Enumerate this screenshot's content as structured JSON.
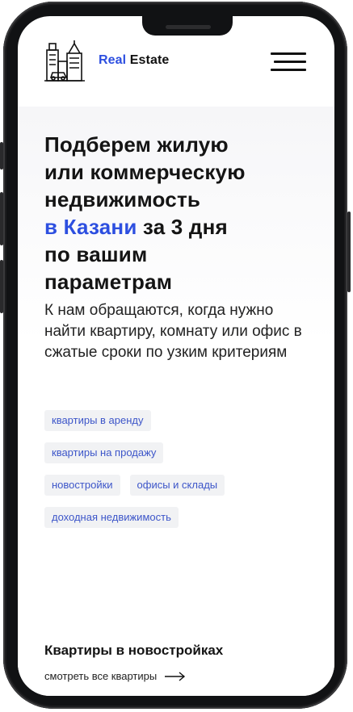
{
  "header": {
    "brand_accent": "Real",
    "brand_rest": " Estate",
    "logo_icon": "city-buildings-icon",
    "menu_icon": "hamburger-menu-icon"
  },
  "hero": {
    "headline_line1": "Подберем жилую",
    "headline_line2": "или коммерческую",
    "headline_line3": "недвижимость",
    "headline_accent": "в Казани",
    "headline_after_accent": " за 3 дня",
    "headline_line5": "по вашим",
    "headline_line6": "параметрам",
    "subtitle": "К нам обращаются, когда нужно найти квартиру, комнату или офис в сжатые сроки по узким критериям"
  },
  "tags": [
    [
      "квартиры в аренду"
    ],
    [
      "квартиры на продажу"
    ],
    [
      "новостройки",
      "офисы и склады"
    ],
    [
      "доходная недвижимость"
    ]
  ],
  "section": {
    "title": "Квартиры в новостройках",
    "see_all": "смотреть все квартиры",
    "arrow_icon": "arrow-right-icon"
  },
  "colors": {
    "accent": "#2d4fe0",
    "tag_text": "#3d56c9",
    "tag_bg": "#f1f2f4",
    "text": "#141414"
  }
}
